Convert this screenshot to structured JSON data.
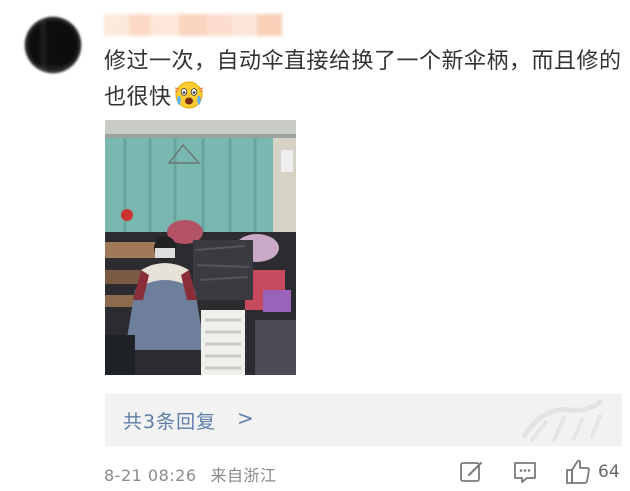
{
  "comment": {
    "text": "修过一次，自动伞直接给换了一个新伞柄，而且修的也很快",
    "emoji": "astonished-crying-face-emoji"
  },
  "replies": {
    "label": "共3条回复",
    "chevron": ">"
  },
  "meta": {
    "date": "8-21 08:26",
    "location": "来自浙江"
  },
  "actions": {
    "like_count": "64"
  },
  "icons": {
    "edit": "edit-icon",
    "comment": "comment-icon",
    "like": "thumbs-up-icon"
  },
  "colors": {
    "reply_link": "#5e7ea8",
    "text": "#333333",
    "meta": "#8a8a8a"
  }
}
